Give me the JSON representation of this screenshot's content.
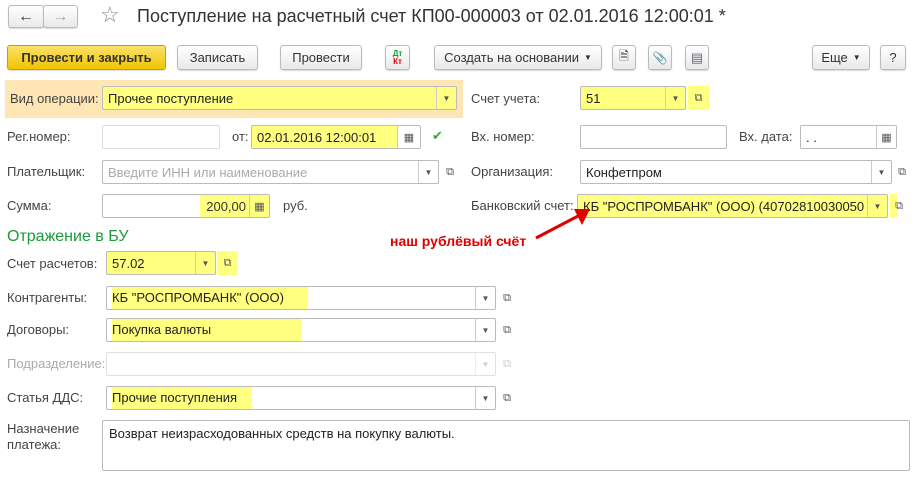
{
  "window": {
    "title": "Поступление на расчетный счет КП00-000003 от 02.01.2016 12:00:01 *"
  },
  "toolbar": {
    "post_close": "Провести и закрыть",
    "save": "Записать",
    "post": "Провести",
    "dtkt_dt": "Дт",
    "dtkt_kt": "Кт",
    "create_based": "Создать на основании",
    "more": "Еще",
    "help": "?"
  },
  "form": {
    "operation_label": "Вид операции:",
    "operation_value": "Прочее поступление",
    "account_label": "Счет учета:",
    "account_value": "51",
    "regnum_label": "Рег.номер:",
    "regnum_value": "",
    "from_label": "от:",
    "from_value": "02.01.2016 12:00:01",
    "in_num_label": "Вх. номер:",
    "in_num_value": "",
    "in_date_label": "Вх. дата:",
    "in_date_value": " .  .",
    "payer_label": "Плательщик:",
    "payer_placeholder": "Введите ИНН или наименование",
    "org_label": "Организация:",
    "org_value": "Конфетпром",
    "sum_label": "Сумма:",
    "sum_value": "200,00",
    "sum_unit": "руб.",
    "bank_label": "Банковский счет:",
    "bank_value": "КБ \"РОСПРОМБАНК\" (ООО) (40702810030050",
    "section_title": "Отражение в БУ",
    "settle_label": "Счет расчетов:",
    "settle_value": "57.02",
    "counterparty_label": "Контрагенты:",
    "counterparty_value": "КБ \"РОСПРОМБАНК\" (ООО)",
    "contract_label": "Договоры:",
    "contract_value": "Покупка валюты",
    "division_label": "Подразделение:",
    "division_value": "",
    "dds_label": "Статья ДДС:",
    "dds_value": "Прочие поступления",
    "purpose_label_1": "Назначение",
    "purpose_label_2": "платежа:",
    "purpose_value": "Возврат неизрасходованных средств на покупку валюты."
  },
  "annotation": {
    "text": "наш рублёвый счёт",
    "color": "#e00000"
  },
  "colors": {
    "accent_button": "#f5d020",
    "highlight": "#ffff80",
    "section": "#1a9a3a"
  }
}
